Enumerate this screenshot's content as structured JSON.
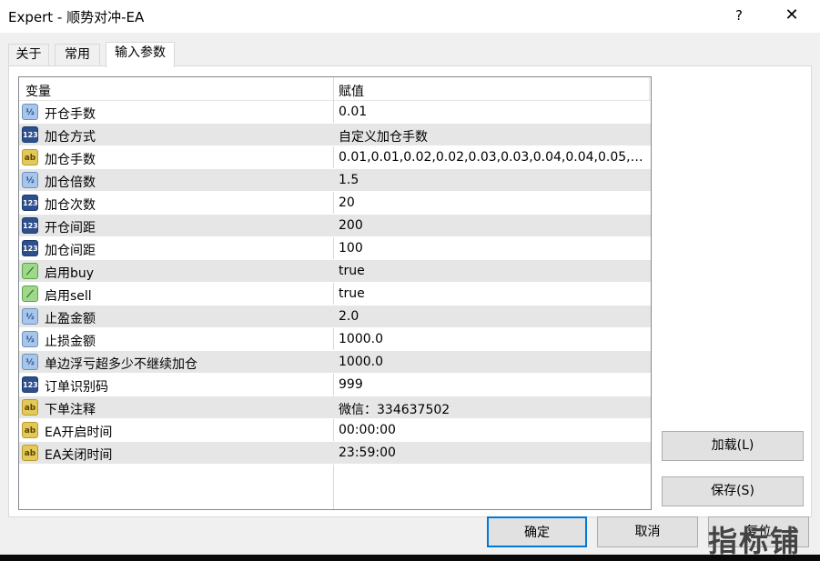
{
  "window": {
    "title": "Expert - 顺势对冲-EA",
    "help_glyph": "?",
    "close_glyph": "✕"
  },
  "tabs": [
    {
      "label": "关于",
      "active": false
    },
    {
      "label": "常用",
      "active": false
    },
    {
      "label": "输入参数",
      "active": true
    }
  ],
  "grid": {
    "columns": [
      "变量",
      "赋值"
    ],
    "rows": [
      {
        "icon": "double-icon",
        "icon_text": "½",
        "name": "开仓手数",
        "value": "0.01"
      },
      {
        "icon": "integer-icon",
        "icon_text": "123",
        "name": "加仓方式",
        "value": "自定义加仓手数"
      },
      {
        "icon": "string-icon",
        "icon_text": "ab",
        "name": "加仓手数",
        "value": "0.01,0.01,0.02,0.02,0.03,0.03,0.04,0.04,0.05,0..."
      },
      {
        "icon": "double-icon",
        "icon_text": "½",
        "name": "加仓倍数",
        "value": "1.5"
      },
      {
        "icon": "integer-icon",
        "icon_text": "123",
        "name": "加仓次数",
        "value": "20"
      },
      {
        "icon": "integer-icon",
        "icon_text": "123",
        "name": "开仓间距",
        "value": "200"
      },
      {
        "icon": "integer-icon",
        "icon_text": "123",
        "name": "加仓间距",
        "value": "100"
      },
      {
        "icon": "boolean-icon",
        "icon_text": "⟋",
        "name": "启用buy",
        "value": "true"
      },
      {
        "icon": "boolean-icon",
        "icon_text": "⟋",
        "name": "启用sell",
        "value": "true"
      },
      {
        "icon": "double-icon",
        "icon_text": "½",
        "name": "止盈金额",
        "value": "2.0"
      },
      {
        "icon": "double-icon",
        "icon_text": "½",
        "name": "止损金额",
        "value": "1000.0"
      },
      {
        "icon": "double-icon",
        "icon_text": "½",
        "name": "单边浮亏超多少不继续加仓",
        "value": "1000.0"
      },
      {
        "icon": "integer-icon",
        "icon_text": "123",
        "name": "订单识别码",
        "value": "999"
      },
      {
        "icon": "string-icon",
        "icon_text": "ab",
        "name": "下单注释",
        "value": "微信：334637502"
      },
      {
        "icon": "string-icon",
        "icon_text": "ab",
        "name": "EA开启时间",
        "value": "00:00:00"
      },
      {
        "icon": "string-icon",
        "icon_text": "ab",
        "name": "EA关闭时间",
        "value": "23:59:00"
      }
    ]
  },
  "buttons": {
    "load": "加载(L)",
    "save": "保存(S)",
    "ok": "确定",
    "cancel": "取消",
    "help": "复位"
  },
  "watermark": "指标铺"
}
